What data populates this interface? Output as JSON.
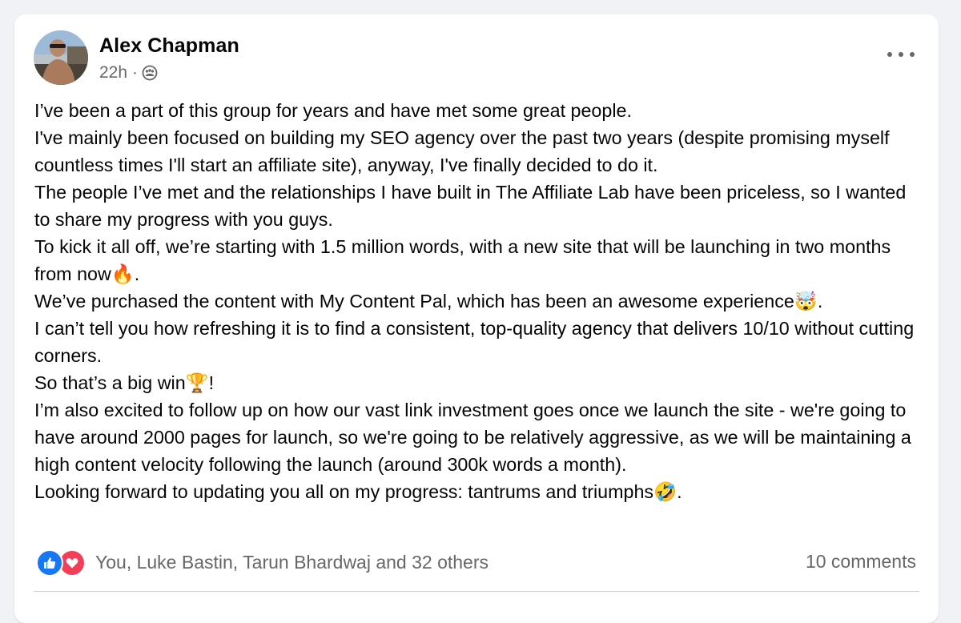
{
  "post": {
    "author": "Alex Chapman",
    "timestamp": "22h",
    "separator": "·",
    "audience_icon": "group-icon",
    "lines": [
      "I’ve been a part of this group for years and have met some great people.",
      "I've mainly been focused on building my SEO agency over the past two years (despite promising myself countless times I'll start an affiliate site), anyway, I've finally decided to do it.",
      "The people I’ve met and the relationships I have built in The Affiliate Lab have been priceless, so I wanted to share my progress with you guys.",
      "To kick it all off, we’re starting with 1.5 million words, with a new site that will be launching in two months from now🔥.",
      "We’ve purchased the content with My Content Pal, which has been an awesome experience🤯.",
      "I can’t tell you how refreshing it is to find a consistent, top-quality agency that delivers 10/10 without cutting corners.",
      "So that’s a big win🏆!",
      "I’m also excited to follow up on how our vast link investment goes once we launch the site - we're going to have around 2000 pages for launch, so we're going to be relatively aggressive, as we will be maintaining a high content velocity following the launch (around 300k words a month).",
      "Looking forward to updating you all on my progress: tantrums and triumphs🤣."
    ]
  },
  "reactions": {
    "icons": [
      "like-icon",
      "love-icon"
    ],
    "names": "You, Luke Bastin, Tarun Bhardwaj and 32 others"
  },
  "comments": {
    "count_label": "10 comments"
  },
  "colors": {
    "like": "#1877f2",
    "love": "#f33e58",
    "secondary_text": "#65676b",
    "primary_text": "#050505"
  }
}
